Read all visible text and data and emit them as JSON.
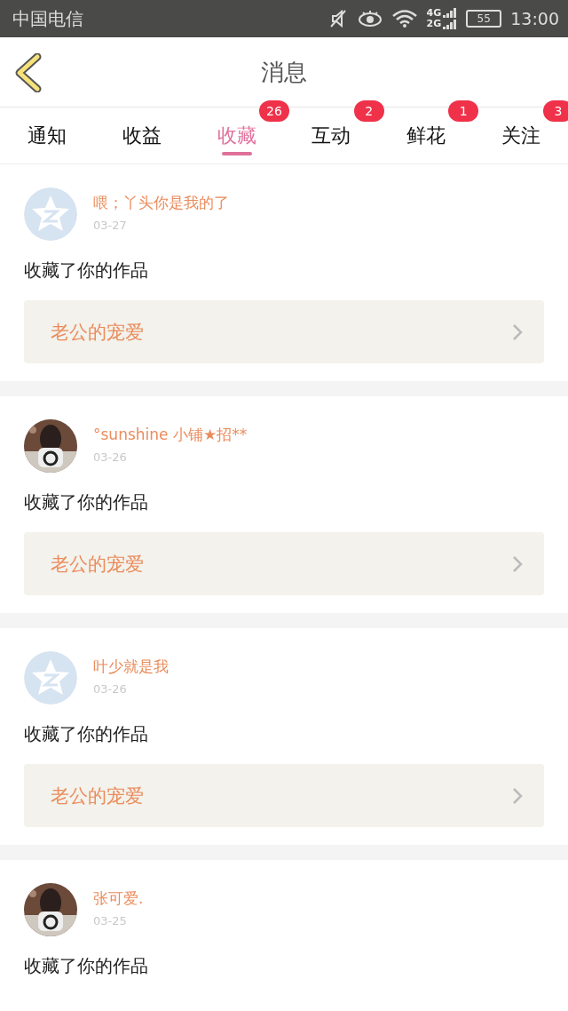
{
  "status_bar": {
    "carrier": "中国电信",
    "network_labels": [
      "4G",
      "2G"
    ],
    "battery": "55",
    "time": "13:00"
  },
  "header": {
    "title": "消息"
  },
  "tabs": [
    {
      "label": "通知",
      "selected": false
    },
    {
      "label": "收益",
      "selected": false
    },
    {
      "label": "收藏",
      "selected": true,
      "badge": "26"
    },
    {
      "label": "互动",
      "selected": false,
      "badge": "2"
    },
    {
      "label": "鲜花",
      "selected": false,
      "badge": "1"
    },
    {
      "label": "关注",
      "selected": false,
      "badge": "3"
    }
  ],
  "messages": [
    {
      "kind": "default",
      "name": "喂；丫头你是我的了",
      "date": "03-27",
      "text": "收藏了你的作品",
      "link": "老公的宠爱"
    },
    {
      "kind": "picture",
      "name": "°sunshine 小铺★招**",
      "date": "03-26",
      "text": "收藏了你的作品",
      "link": "老公的宠爱"
    },
    {
      "kind": "default",
      "name": "叶少就是我",
      "date": "03-26",
      "text": "收藏了你的作品",
      "link": "老公的宠爱"
    },
    {
      "kind": "picture",
      "name": "张可爱.",
      "date": "03-25",
      "text": "收藏了你的作品"
    }
  ]
}
